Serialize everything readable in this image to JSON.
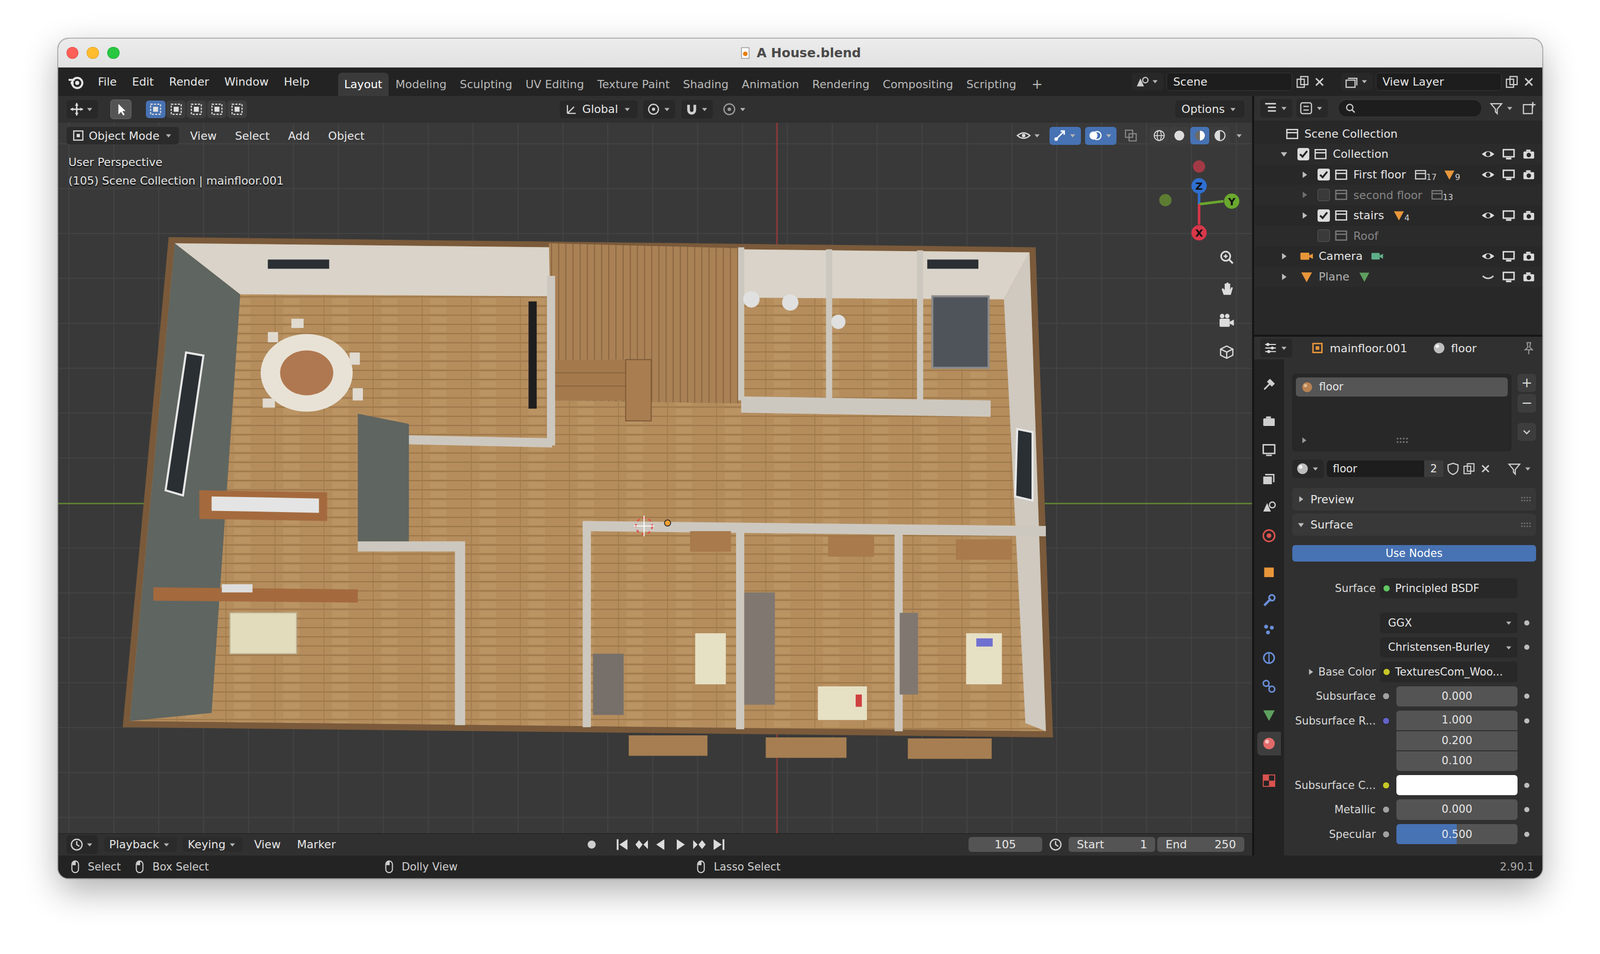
{
  "window": {
    "title": "A House.blend"
  },
  "menu": [
    "File",
    "Edit",
    "Render",
    "Window",
    "Help"
  ],
  "workspaces": [
    {
      "label": "Layout",
      "selected": true
    },
    {
      "label": "Modeling",
      "selected": false
    },
    {
      "label": "Sculpting",
      "selected": false
    },
    {
      "label": "UV Editing",
      "selected": false
    },
    {
      "label": "Texture Paint",
      "selected": false
    },
    {
      "label": "Shading",
      "selected": false
    },
    {
      "label": "Animation",
      "selected": false
    },
    {
      "label": "Rendering",
      "selected": false
    },
    {
      "label": "Compositing",
      "selected": false
    },
    {
      "label": "Scripting",
      "selected": false
    }
  ],
  "add_workspace": "+",
  "scene": "Scene",
  "view_layer": "View Layer",
  "tool_header": {
    "select_modes": [
      {
        "selected": true
      },
      {
        "selected": false
      },
      {
        "selected": false
      },
      {
        "selected": false
      },
      {
        "selected": false
      }
    ],
    "orientation": "Global",
    "options": "Options"
  },
  "viewport": {
    "mode": "Object Mode",
    "menus": [
      "View",
      "Select",
      "Add",
      "Object"
    ],
    "shading": [
      {
        "selected": false
      },
      {
        "selected": false
      },
      {
        "selected": true
      },
      {
        "selected": false
      }
    ],
    "perspective": "User Perspective",
    "info": "(105) Scene Collection | mainfloor.001",
    "axes": {
      "z": "Z",
      "y": "Y",
      "x": "X"
    }
  },
  "outliner": {
    "items": [
      {
        "label": "Scene Collection",
        "kind": "scene_collection",
        "expandable": false,
        "expanded": true,
        "has_checkbox": false,
        "checked": false,
        "enabled": true,
        "restrict_shown": false,
        "visible": true,
        "badges": [],
        "children": [
          {
            "label": "Collection",
            "kind": "collection",
            "expandable": true,
            "expanded": true,
            "has_checkbox": true,
            "checked": true,
            "enabled": true,
            "restrict_shown": true,
            "visible": true,
            "badges": [],
            "children": [
              {
                "label": "First floor",
                "kind": "collection",
                "expandable": true,
                "expanded": false,
                "has_checkbox": true,
                "checked": true,
                "enabled": true,
                "restrict_shown": true,
                "visible": true,
                "badges": [
                  {
                    "kind": "collection",
                    "count": "17"
                  },
                  {
                    "kind": "mesh",
                    "count": "9"
                  }
                ],
                "children": []
              },
              {
                "label": "second floor",
                "kind": "collection",
                "expandable": true,
                "expanded": false,
                "has_checkbox": true,
                "checked": false,
                "enabled": false,
                "restrict_shown": false,
                "visible": true,
                "badges": [
                  {
                    "kind": "collection",
                    "count": "13"
                  }
                ],
                "children": []
              },
              {
                "label": "stairs",
                "kind": "collection",
                "expandable": true,
                "expanded": false,
                "has_checkbox": true,
                "checked": true,
                "enabled": true,
                "restrict_shown": true,
                "visible": true,
                "badges": [
                  {
                    "kind": "mesh",
                    "count": "4"
                  }
                ],
                "children": []
              },
              {
                "label": "Roof",
                "kind": "collection",
                "expandable": false,
                "expanded": false,
                "has_checkbox": true,
                "checked": false,
                "enabled": false,
                "restrict_shown": false,
                "visible": true,
                "badges": [],
                "children": []
              }
            ]
          },
          {
            "label": "Camera",
            "kind": "camera",
            "expandable": true,
            "expanded": false,
            "has_checkbox": false,
            "checked": false,
            "enabled": true,
            "restrict_shown": true,
            "visible": true,
            "badges": [
              {
                "kind": "camera_data"
              }
            ],
            "children": []
          },
          {
            "label": "Plane",
            "kind": "mesh",
            "expandable": true,
            "expanded": false,
            "has_checkbox": false,
            "checked": false,
            "enabled": true,
            "restrict_shown": true,
            "visible": false,
            "badges": [
              {
                "kind": "mesh_data"
              }
            ],
            "children": []
          }
        ]
      }
    ]
  },
  "properties": {
    "object": "mainfloor.001",
    "material": "floor",
    "tabs": [
      {
        "selected": false,
        "color": "#cfcfcf"
      },
      {
        "selected": false,
        "color": "#cfcfcf"
      },
      {
        "selected": false,
        "color": "#cfcfcf"
      },
      {
        "selected": false,
        "color": "#cfcfcf"
      },
      {
        "selected": false,
        "color": "#cfcfcf"
      },
      {
        "selected": false,
        "color": "#d9534f"
      },
      {
        "selected": false,
        "color": "#e8963a"
      },
      {
        "selected": false,
        "color": "#6a8fd8"
      },
      {
        "selected": false,
        "color": "#6a8fd8"
      },
      {
        "selected": false,
        "color": "#6a8fd8"
      },
      {
        "selected": false,
        "color": "#6a8fd8"
      },
      {
        "selected": false,
        "color": "#5ea05e"
      },
      {
        "selected": true,
        "color": "#e26a6a"
      },
      {
        "selected": false,
        "color": "#d9534f"
      }
    ],
    "slots": [
      {
        "label": "floor",
        "selected": true
      }
    ],
    "slot_buttons": [
      "+",
      "−"
    ],
    "material_field": "floor",
    "users": "2",
    "sections": [
      {
        "label": "Preview",
        "expanded": false
      },
      {
        "label": "Surface",
        "expanded": true
      }
    ],
    "use_nodes": {
      "label": "Use Nodes",
      "on": true
    },
    "rows": [
      {
        "kind": "socket",
        "label": "Surface",
        "value": "Principled BSDF",
        "color": "#63c763",
        "expandable": false
      },
      {
        "kind": "dropdown",
        "value": "GGX",
        "expandable": false
      },
      {
        "kind": "dropdown",
        "value": "Christensen-Burley",
        "expandable": false
      },
      {
        "kind": "socket",
        "label": "Base Color",
        "value": "TexturesCom_Woo...",
        "color": "#c7c729",
        "expandable": true
      },
      {
        "kind": "number",
        "label": "Subsurface",
        "value": "0.000",
        "color": "#a1a1a1",
        "expandable": false
      },
      {
        "kind": "vector",
        "label": "Subsurface R...",
        "values": [
          "1.000",
          "0.200",
          "0.100"
        ],
        "color": "#6363c7",
        "expandable": false
      },
      {
        "kind": "color",
        "label": "Subsurface C...",
        "swatch": "#ffffff",
        "color": "#c7c729",
        "expandable": false
      },
      {
        "kind": "number",
        "label": "Metallic",
        "value": "0.000",
        "color": "#a1a1a1",
        "expandable": false
      },
      {
        "kind": "slider",
        "label": "Specular",
        "value": "0.500",
        "level": 0.5,
        "color": "#a1a1a1",
        "expandable": false
      }
    ]
  },
  "timeline": {
    "menus": [
      {
        "label": "Playback",
        "dropdown": true
      },
      {
        "label": "Keying",
        "dropdown": true
      },
      {
        "label": "View",
        "dropdown": false
      },
      {
        "label": "Marker",
        "dropdown": false
      }
    ],
    "frame": "105",
    "start_label": "Start",
    "start": "1",
    "end_label": "End",
    "end": "250"
  },
  "status_bar": {
    "items": [
      "Select",
      "Box Select",
      "Dolly View",
      "Lasso Select"
    ],
    "version": "2.90.1"
  }
}
